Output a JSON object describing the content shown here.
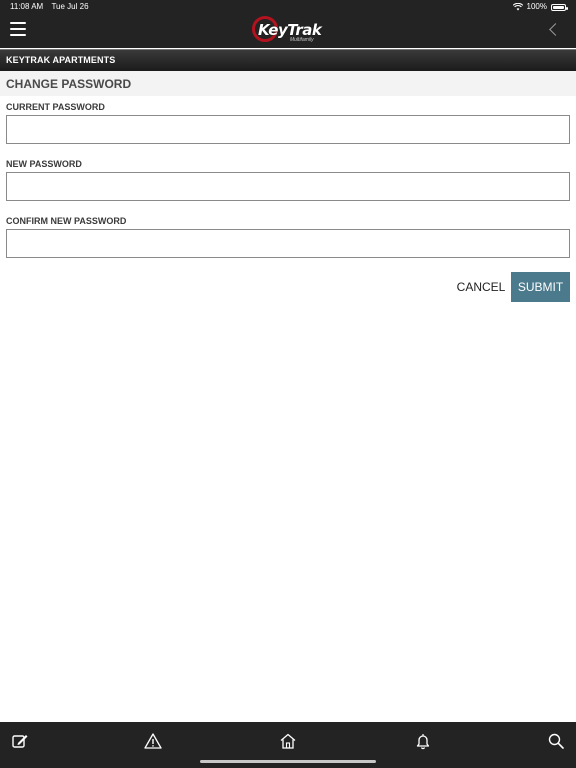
{
  "status_bar": {
    "time": "11:08 AM",
    "date": "Tue Jul 26",
    "battery": "100%"
  },
  "header": {
    "logo_text": "KeyTrak",
    "logo_subtext": "Multifamily"
  },
  "property_bar": {
    "name": "KEYTRAK APARTMENTS"
  },
  "page": {
    "title": "CHANGE PASSWORD"
  },
  "form": {
    "current_password": {
      "label": "CURRENT PASSWORD",
      "value": ""
    },
    "new_password": {
      "label": "NEW PASSWORD",
      "value": ""
    },
    "confirm_password": {
      "label": "CONFIRM NEW PASSWORD",
      "value": ""
    },
    "cancel_label": "CANCEL",
    "submit_label": "SUBMIT"
  },
  "tabbar": {
    "icons": [
      "edit-icon",
      "warning-icon",
      "home-icon",
      "bell-icon",
      "search-icon"
    ]
  },
  "colors": {
    "dark_bg": "#232323",
    "accent": "#4a7a8c",
    "logo_red": "#b3121f"
  }
}
